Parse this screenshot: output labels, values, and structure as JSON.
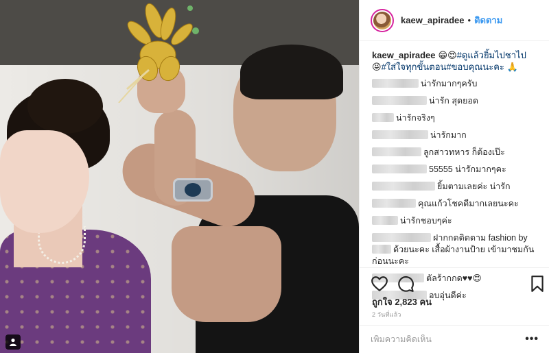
{
  "post": {
    "username": "kaew_apiradee",
    "follow_label": "ติดตาม",
    "separator": "•"
  },
  "caption": {
    "username": "kaew_apiradee",
    "emoji1": "😁😍",
    "tag1": "#ดูแล้วยิ้มไปชาไป",
    "emoji2": "😝",
    "tag2": "#ใส่ใจทุกขั้นตอน",
    "tag3": "#ขอบคุณนะคะ",
    "emoji3": "🙏"
  },
  "comments": [
    {
      "text": "น่ารักมากๆครับ"
    },
    {
      "text": "น่ารัก สุดยอด"
    },
    {
      "text": "น่ารักจริงๆ"
    },
    {
      "text": "น่ารักมาก"
    },
    {
      "text": "ลูกสาวทหาร ก็ต้องเป๊ะ"
    },
    {
      "text": "55555 น่ารักมากๆคะ"
    },
    {
      "text": "ยิ้มตามเลยค่ะ น่ารัก"
    },
    {
      "text": "คุณแก้วโชคดีมากเลยนะคะ"
    },
    {
      "text": "น่ารักชอบๆค่ะ"
    },
    {
      "text_line1": "ฝากกดติดตาม fashion by",
      "text_line2": "ด้วยนะคะ เสื้อผ้างานป้าย เข้ามาชมกัน",
      "text_line3": "ก่อนนะคะ"
    },
    {
      "text": "ตัลร้ากกด♥♥😍"
    },
    {
      "text": "อบอุ่นดีค่ะ"
    }
  ],
  "stats": {
    "likes_label": "ถูกใจ 2,823 คน",
    "time_label": "2 วันที่แล้ว"
  },
  "add_comment": {
    "placeholder": "เพิ่มความคิดเห็น",
    "more_label": "•••"
  },
  "icons": {
    "like": "heart-icon",
    "comment": "comment-icon",
    "save": "bookmark-icon",
    "profile": "user-icon"
  },
  "colors": {
    "follow": "#3897f0",
    "hashtag": "#003569",
    "border": "#efefef",
    "avatar_ring": "#d6249f"
  }
}
